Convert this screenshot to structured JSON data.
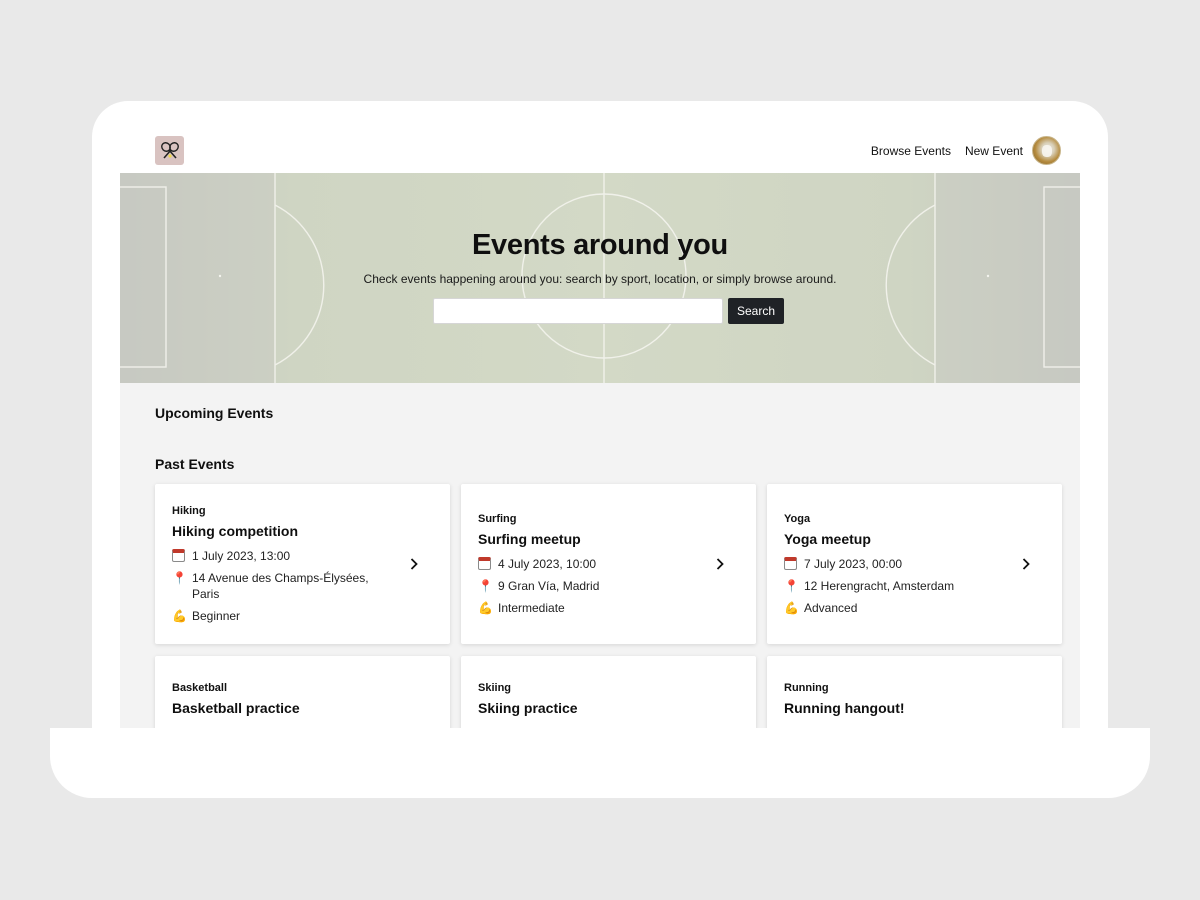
{
  "navbar": {
    "logo_icon": "crossed-tennis-rackets-icon",
    "links": [
      "Browse Events",
      "New Event"
    ],
    "avatar_icon": "user-avatar-icon"
  },
  "hero": {
    "title": "Events around you",
    "subtitle": "Check events happening around you: search by sport, location, or simply browse around.",
    "search": {
      "value": "",
      "placeholder": ""
    },
    "search_button": "Search",
    "background": "soccer-field"
  },
  "sections": {
    "upcoming": "Upcoming Events",
    "past": "Past Events"
  },
  "events": [
    {
      "sport": "Hiking",
      "title": "Hiking competition",
      "date": "1 July 2023, 13:00",
      "location": "14 Avenue des Champs-Élysées, Paris",
      "level": "Beginner"
    },
    {
      "sport": "Surfing",
      "title": "Surfing meetup",
      "date": "4 July 2023, 10:00",
      "location": "9 Gran Vía, Madrid",
      "level": "Intermediate"
    },
    {
      "sport": "Yoga",
      "title": "Yoga meetup",
      "date": "7 July 2023, 00:00",
      "location": "12 Herengracht, Amsterdam",
      "level": "Advanced"
    },
    {
      "sport": "Basketball",
      "title": "Basketball practice"
    },
    {
      "sport": "Skiing",
      "title": "Skiing practice"
    },
    {
      "sport": "Running",
      "title": "Running hangout!"
    }
  ],
  "icons": {
    "date": "calendar-icon",
    "location": "pin-icon",
    "level": "flexed-biceps-icon",
    "open": "chevron-right-icon"
  },
  "colors": {
    "accent_button": "#1f2226",
    "logo_bg": "#d9c3c1",
    "field": "#cdd3c2"
  }
}
